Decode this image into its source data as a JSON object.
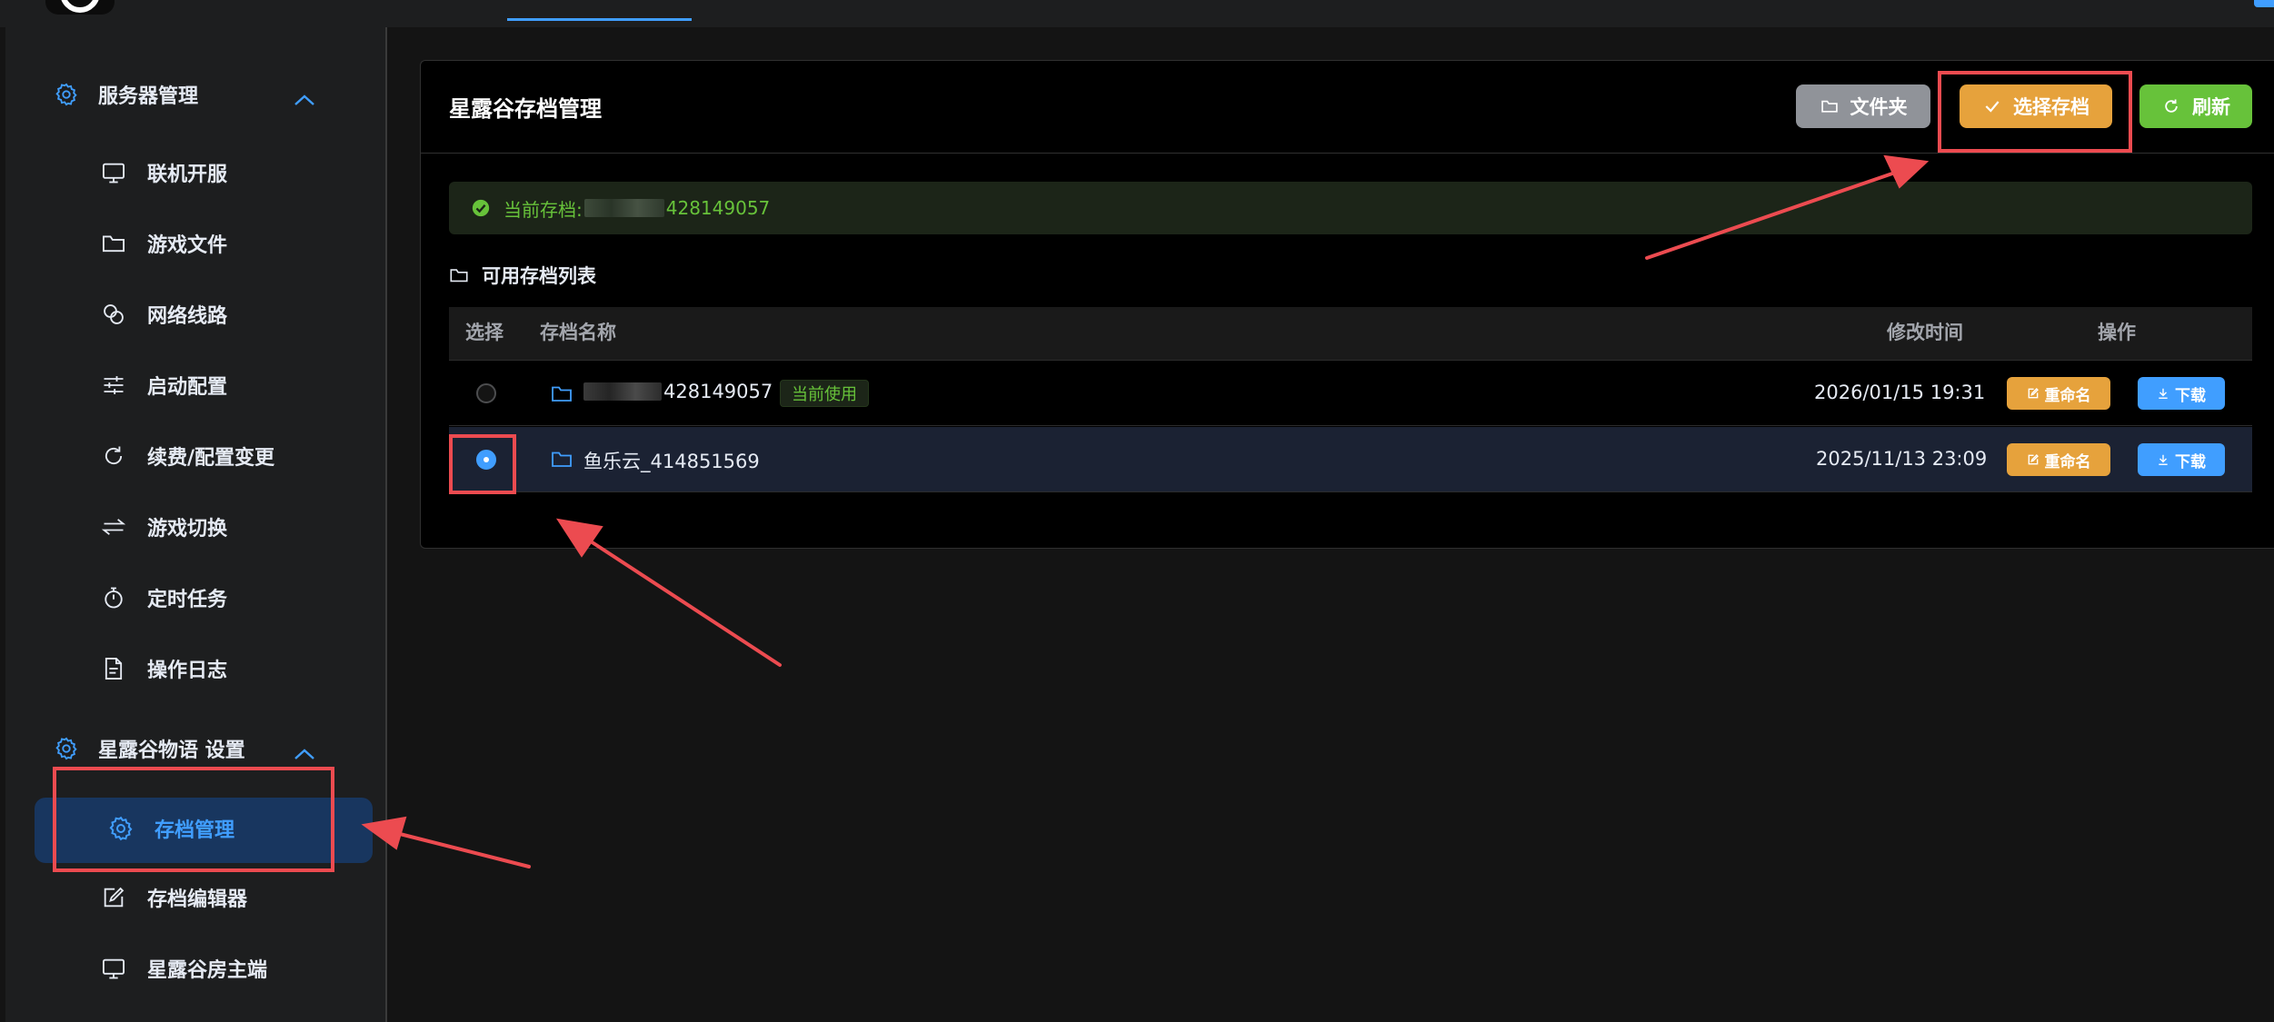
{
  "sidebar": {
    "groups": [
      {
        "label": "服务器管理",
        "icon": "gear-icon"
      },
      {
        "label": "星露谷物语 设置",
        "icon": "gear-icon"
      }
    ],
    "items": [
      {
        "label": "联机开服",
        "icon": "monitor-icon"
      },
      {
        "label": "游戏文件",
        "icon": "folder-icon"
      },
      {
        "label": "网络线路",
        "icon": "link-icon"
      },
      {
        "label": "启动配置",
        "icon": "sliders-icon"
      },
      {
        "label": "续费/配置变更",
        "icon": "refresh-icon"
      },
      {
        "label": "游戏切换",
        "icon": "switch-icon"
      },
      {
        "label": "定时任务",
        "icon": "timer-icon"
      },
      {
        "label": "操作日志",
        "icon": "document-icon"
      },
      {
        "label": "存档管理",
        "icon": "gear-icon"
      },
      {
        "label": "存档编辑器",
        "icon": "edit-icon"
      },
      {
        "label": "星露谷房主端",
        "icon": "monitor-icon"
      }
    ],
    "active_item": "存档管理"
  },
  "card": {
    "title": "星露谷存档管理",
    "buttons": {
      "folder": "文件夹",
      "select": "选择存档",
      "refresh": "刷新"
    }
  },
  "alert": {
    "prefix": "当前存档:",
    "suffix": "428149057"
  },
  "list": {
    "title": "可用存档列表",
    "columns": [
      "选择",
      "存档名称",
      "修改时间",
      "操作"
    ],
    "rows": [
      {
        "name_suffix": "428149057",
        "tag": "当前使用",
        "time": "2026/01/15 19:31",
        "selected": false
      },
      {
        "name": "鱼乐云_414851569",
        "time": "2025/11/13 23:09",
        "selected": true
      }
    ],
    "actions": {
      "rename": "重命名",
      "download": "下载"
    }
  },
  "colors": {
    "primary": "#409eff",
    "warning": "#e6a23c",
    "success": "#67c23a",
    "info": "#909399",
    "annotation": "#ec4b50"
  }
}
